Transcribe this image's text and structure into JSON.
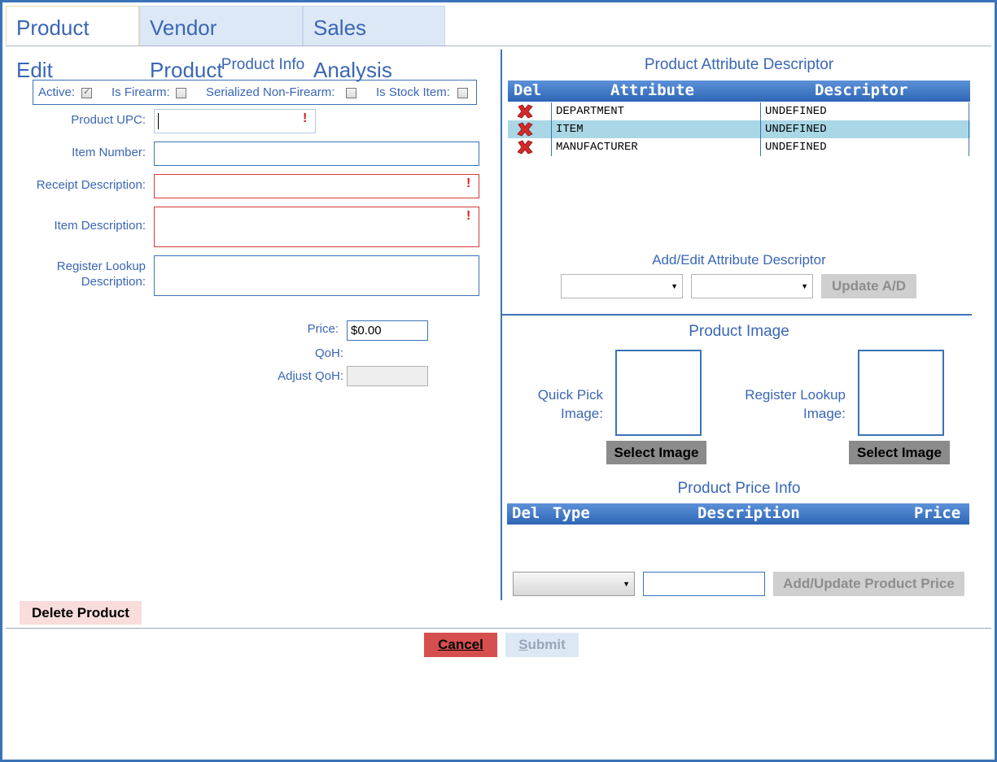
{
  "tabs": [
    {
      "label": "Product Edit",
      "active": true
    },
    {
      "label": "Vendor Product",
      "active": false
    },
    {
      "label": "Sales Analysis",
      "active": false
    }
  ],
  "product_info": {
    "title": "Product Info",
    "flags": {
      "active_label": "Active:",
      "active_checked": true,
      "firearm_label": "Is Firearm:",
      "firearm_checked": false,
      "serialized_label": "Serialized Non-Firearm:",
      "serialized_checked": false,
      "stock_label": "Is Stock Item:",
      "stock_checked": false
    },
    "upc_label": "Product UPC:",
    "upc_value": "",
    "item_number_label": "Item Number:",
    "item_number_value": "",
    "receipt_desc_label": "Receipt Description:",
    "receipt_desc_value": "",
    "item_desc_label": "Item Description:",
    "item_desc_value": "",
    "register_lookup_label_1": "Register Lookup",
    "register_lookup_label_2": "Description:",
    "register_lookup_value": "",
    "price_label": "Price:",
    "price_value": "$0.00",
    "qoh_label": "QoH:",
    "adjust_qoh_label": "Adjust QoH:",
    "required_marker": "!"
  },
  "attribute_descriptor": {
    "title": "Product Attribute Descriptor",
    "columns": {
      "del": "Del",
      "attribute": "Attribute",
      "descriptor": "Descriptor"
    },
    "rows": [
      {
        "attribute": "DEPARTMENT",
        "descriptor": "UNDEFINED",
        "selected": false
      },
      {
        "attribute": "ITEM",
        "descriptor": "UNDEFINED",
        "selected": true
      },
      {
        "attribute": "MANUFACTURER",
        "descriptor": "UNDEFINED",
        "selected": false
      }
    ],
    "add_edit_title": "Add/Edit Attribute Descriptor",
    "attribute_select_value": "",
    "descriptor_select_value": "",
    "update_button": "Update A/D"
  },
  "product_image": {
    "title": "Product Image",
    "quick_pick_label_1": "Quick Pick",
    "quick_pick_label_2": "Image:",
    "register_label_1": "Register Lookup",
    "register_label_2": "Image:",
    "select_button": "Select Image"
  },
  "price_info": {
    "title": "Product Price Info",
    "columns": {
      "del": "Del",
      "type": "Type",
      "description": "Description",
      "price": "Price"
    },
    "type_select_value": "",
    "price_input_value": "",
    "add_button": "Add/Update Product Price"
  },
  "footer": {
    "delete_button": "Delete Product",
    "cancel_first": "C",
    "cancel_rest": "ancel",
    "submit_first": "S",
    "submit_rest": "ubmit"
  },
  "colors": {
    "accent": "#3a73b8",
    "label_text": "#3a66b5",
    "error_border": "#d23a3a",
    "selected_row": "#a9d7e6",
    "cancel_bg": "#d64f4f"
  }
}
